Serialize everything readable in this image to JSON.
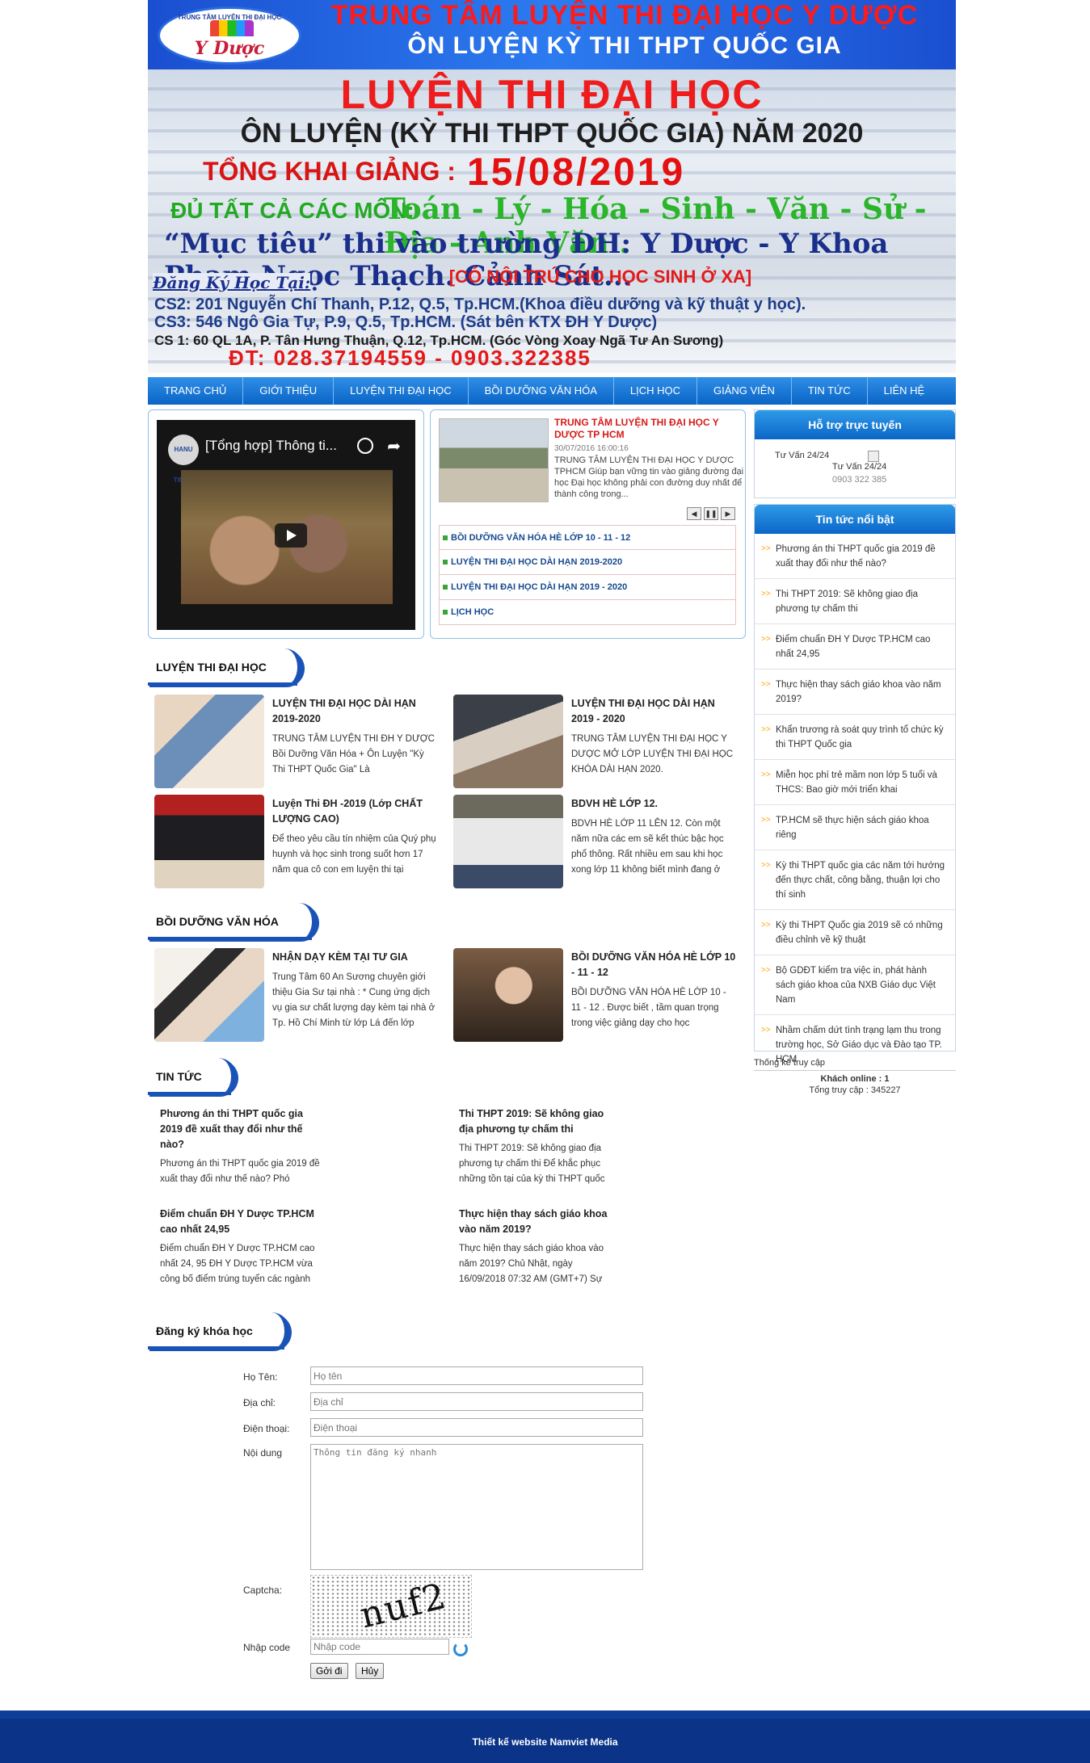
{
  "banner": {
    "logo_arc": "TRUNG TÂM LUYỆN THI ĐẠI HỌC",
    "logo_brand": "Y Dược",
    "line1": "TRUNG TÂM LUYỆN THI ĐẠI HỌC Y DƯỢC",
    "line2": "ÔN LUYỆN KỲ THI THPT QUỐC GIA",
    "line3": "LUYỆN THI ĐẠI HỌC",
    "line4": "ÔN LUYỆN (KỲ THI THPT QUỐC GIA) NĂM 2020",
    "line5a": "TỔNG KHAI GIẢNG :",
    "line5b": "15/08/2019",
    "line6a": "ĐỦ TẤT CẢ CÁC MÔN:",
    "line6b": "Toán - Lý - Hóa - Sinh - Văn - Sử - Địa - Anh Văn .",
    "line7": "“Mục tiêu” thi vào trường ĐH: Y Dược - Y Khoa Phạm Ngọc Thạch. Cảnh Sát...",
    "line8": "[CÓ NỘI TRÚ CHO HỌC SINH Ở XA]",
    "register_label": "Đăng Ký Học Tại:",
    "addr1": "CS2: 201 Nguyễn Chí Thanh, P.12, Q.5, Tp.HCM.(Khoa điều dưỡng và kỹ thuật y học).",
    "addr2": "CS3: 546 Ngô Gia Tự, P.9, Q.5, Tp.HCM. (Sát bên KTX ĐH Y Dược)",
    "addr3": "CS 1: 60 QL 1A, P. Tân Hưng Thuận, Q.12, Tp.HCM. (Góc Vòng Xoay Ngã Tư An Sương)",
    "phone": "ĐT: 028.37194559 - 0903.322385"
  },
  "nav": [
    "TRANG CHỦ",
    "GIỚI THIỆU",
    "LUYỆN THI ĐẠI HỌC",
    "BỒI DƯỠNG VĂN HÓA",
    "LỊCH HỌC",
    "GIẢNG VIÊN",
    "TIN TỨC",
    "LIÊN HỆ"
  ],
  "video": {
    "title": "[Tổng hợp] Thông ti...",
    "channel_logo": "HANU TIMES"
  },
  "slider": {
    "title": "TRUNG TÂM LUYỆN THI ĐẠI HỌC Y DƯỢC TP HCM",
    "date": "30/07/2016 16:00:16",
    "desc": "TRUNG TÂM LUYỆN THI ĐẠI HỌC Y DƯỢC TPHCM        Giúp bạn vững tin vào giảng đường đại học Đại học không phải con đường duy nhất để thành công trong...",
    "controls": [
      "◀",
      "❚❚",
      "▶"
    ],
    "links": [
      "BỒI DƯỠNG VĂN HÓA HÈ LỚP 10 - 11 - 12",
      "LUYỆN THI ĐẠI HỌC DÀI HẠN 2019-2020",
      "LUYỆN THI ĐẠI HỌC DÀI HẠN 2019 - 2020",
      "LỊCH HỌC"
    ]
  },
  "support": {
    "head": "Hỗ trợ trực tuyến",
    "v1": "Tư Vấn 24/24",
    "v2": "Tư Vấn 24/24",
    "phone": "0903 322 385"
  },
  "hot": {
    "head": "Tin tức nổi bật",
    "items": [
      "Phương án thi THPT quốc gia 2019 đề xuất thay đổi như thế nào?",
      "Thi THPT 2019: Sẽ không giao địa phương tự chấm thi",
      "Điểm chuẩn ĐH Y Dược TP.HCM cao nhất 24,95",
      "Thực hiện thay sách giáo khoa vào năm 2019?",
      "Khẩn trương rà soát quy trình tổ chức kỳ thi THPT Quốc gia",
      "Miễn học phí trẻ mầm non lớp 5 tuổi và THCS: Bao giờ mới triển khai",
      "TP.HCM sẽ thực hiện sách giáo khoa riêng",
      "Kỳ thi THPT quốc gia các năm tới hướng đến thực chất, công bằng, thuận lợi cho thí sinh",
      "Kỳ thi THPT Quốc gia 2019 sẽ có những điều chỉnh về kỹ thuật",
      "Bộ GDĐT kiểm tra việc in, phát hành sách giáo khoa của NXB Giáo dục Việt Nam",
      "Nhầm chấm dứt tình trạng lạm thu trong trường học, Sở Giáo dục và Đào tạo TP. HCM"
    ]
  },
  "stats": {
    "head": "Thống kê truy cập",
    "online": "Khách online : 1",
    "total": "Tổng truy cập : 345227"
  },
  "sections": {
    "ltdh": "LUYỆN THI ĐẠI HỌC",
    "bdvh": "BỒI DƯỠNG VĂN HÓA",
    "tintuc": "TIN TỨC",
    "dangky": "Đăng ký khóa học"
  },
  "ltdh_articles": [
    {
      "title": "LUYỆN THI ĐẠI HỌC DÀI HẠN 2019-2020",
      "desc": "TRUNG TÂM LUYỆN THI ĐH Y DƯỢC Bồi Dưỡng Văn Hóa + Ôn Luyện \"Kỳ Thi THPT Quốc Gia\" Là"
    },
    {
      "title": "LUYỆN THI ĐẠI HỌC DÀI HẠN 2019 - 2020",
      "desc": "TRUNG TÂM LUYỆN THI ĐẠI HỌC Y DƯỢC MỞ LỚP LUYỆN THI ĐẠI HỌC KHÓA DÀI HẠN 2020."
    },
    {
      "title": "Luyện Thi ĐH -2019 (Lớp CHẤT LƯỢNG CAO)",
      "desc": "Để theo yêu cầu tín nhiệm của Quý phụ huynh và học sinh trong suốt hơn 17 năm qua cô con em luyện thi tại"
    },
    {
      "title": "BDVH HÈ LỚP 12.",
      "desc": "BDVH HÈ LỚP 11 LÊN 12. Còn một năm nữa các em sẽ kết thúc bậc học phổ thông. Rất nhiều em sau khi học xong lớp 11 không biết mình đang ở"
    }
  ],
  "bdvh_articles": [
    {
      "title": "NHẬN DẠY KÈM TẠI TƯ GIA",
      "desc": "Trung Tâm 60 An Sương chuyên giới thiệu Gia Sư tại nhà : * Cung ứng dịch vụ gia sư chất lượng dạy kèm tại nhà ở Tp. Hồ Chí Minh từ lớp Lá đến lớp"
    },
    {
      "title": "BỒI DƯỠNG VĂN HÓA HÈ LỚP 10 - 11 - 12",
      "desc": "BỒI DƯỠNG VĂN HÓA HÈ LỚP 10 - 11 - 12 . Được biết , tầm quan trọng trong việc giảng dạy cho học"
    }
  ],
  "tintuc": [
    {
      "title": "Phương án thi THPT quốc gia 2019 đề xuất thay đổi như thế nào?",
      "desc": "Phương án thi THPT quốc gia 2019 đề xuất thay đổi như thế nào?    Phó"
    },
    {
      "title": "Thi THPT 2019: Sẽ không giao địa phương tự chấm thi",
      "desc": "Thi THPT 2019: Sẽ không giao địa phương tự chấm thi Để khắc phục những tồn tại của kỳ thi THPT quốc"
    },
    {
      "title": "Điểm chuẩn ĐH Y Dược TP.HCM cao nhất 24,95",
      "desc": "Điểm chuẩn ĐH Y Dược TP.HCM cao nhất 24, 95  ĐH Y Dược TP.HCM vừa công bố điểm trúng tuyển các ngành"
    },
    {
      "title": "Thực hiện thay sách giáo khoa vào năm 2019?",
      "desc": "Thực hiện thay sách giáo khoa vào năm 2019? Chủ Nhật, ngày 16/09/2018 07:32 AM (GMT+7) Sự"
    }
  ],
  "form": {
    "name_label": "Họ Tên:",
    "name_ph": "Họ tên",
    "addr_label": "Địa chỉ:",
    "addr_ph": "Địa chỉ",
    "phone_label": "Điện thoại:",
    "phone_ph": "Điện thoại",
    "content_label": "Nội dung",
    "content_ph": "Thông tin đăng ký nhanh",
    "captcha_label": "Captcha:",
    "captcha_text": "nuf2",
    "code_label": "Nhập code",
    "code_ph": "Nhập code",
    "submit": "Gởi đi",
    "cancel": "Hủy"
  },
  "footer": "Thiết kế website Namviet Media"
}
